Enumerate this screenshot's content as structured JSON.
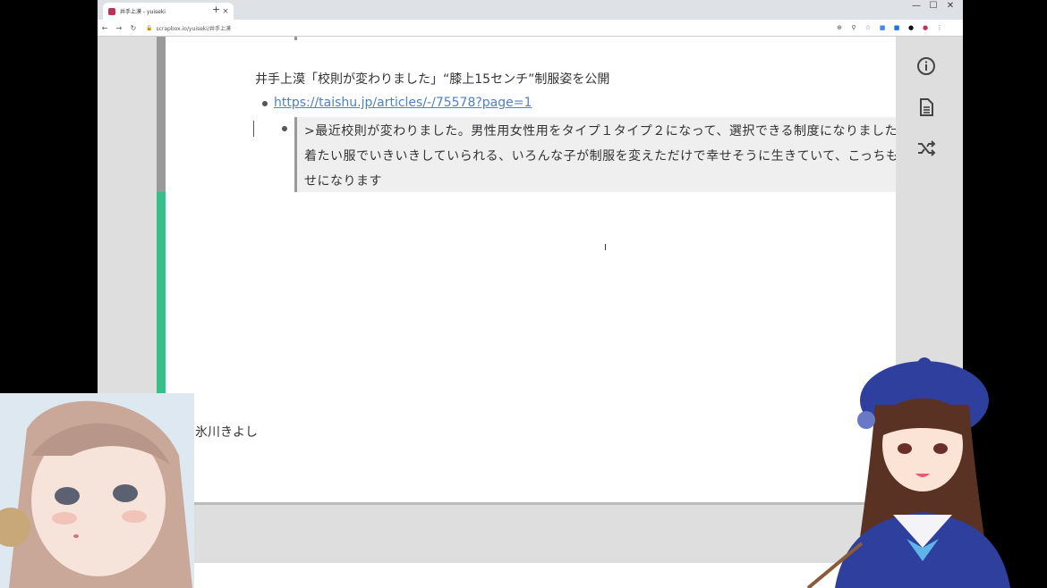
{
  "browser": {
    "tab_title": "井手上漠 - yuiseki",
    "url": "scrapbox.io/yuiseki/井手上漠",
    "nav_icons": [
      "back-arrow-icon",
      "forward-arrow-icon",
      "reload-icon"
    ],
    "window_controls": [
      "—",
      "☐",
      "✕"
    ]
  },
  "page": {
    "heading": "井手上漠「校則が変わりました」“膝上15センチ”制服姿を公開",
    "link": "https://taishu.jp/articles/-/75578?page=1",
    "quote": ">最近校則が変わりました。男性用女性用をタイプ１タイプ２になって、選択できる制度になりました。着たい服でいきいきしていられる、いろんな子が制服を変えただけで幸せそうに生きていて、こっちも幸せになります"
  },
  "overlay": {
    "author": "氷川きよし"
  },
  "colors": {
    "accent_green": "#35c08a",
    "link_blue": "#4e82c4"
  }
}
